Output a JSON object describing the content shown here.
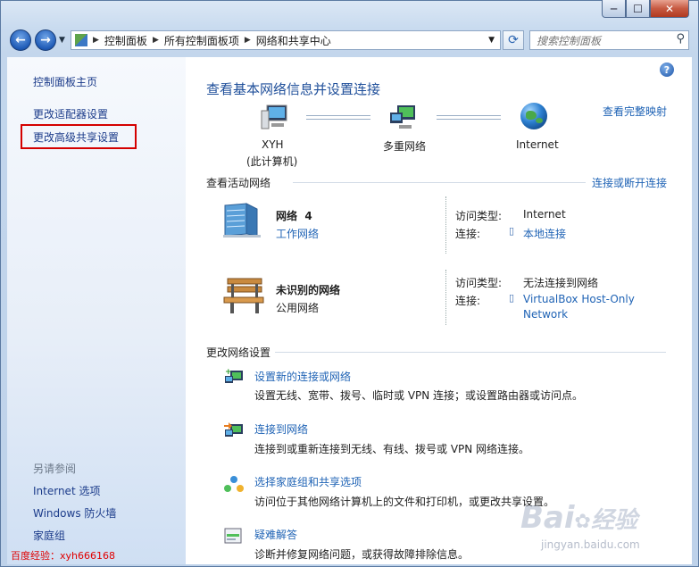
{
  "window": {
    "min_glyph": "─",
    "max_glyph": "☐",
    "close_glyph": "✕"
  },
  "address": {
    "crumbs": [
      "控制面板",
      "所有控制面板项",
      "网络和共享中心"
    ],
    "search_placeholder": "搜索控制面板"
  },
  "sidebar": {
    "home": "控制面板主页",
    "links": [
      "更改适配器设置",
      "更改高级共享设置"
    ],
    "see_also_title": "另请参阅",
    "see_also": [
      "Internet 选项",
      "Windows 防火墙",
      "家庭组"
    ]
  },
  "main": {
    "title": "查看基本网络信息并设置连接",
    "full_map": "查看完整映射",
    "map": {
      "computer_name": "XYH",
      "computer_sub": "(此计算机)",
      "multi": "多重网络",
      "internet": "Internet"
    },
    "active_title": "查看活动网络",
    "connect_link": "连接或断开连接",
    "networks": [
      {
        "name": "网络  4",
        "type": "工作网络",
        "access_label": "访问类型:",
        "access": "Internet",
        "conn_label": "连接:",
        "conn": "本地连接"
      },
      {
        "name": "未识别的网络",
        "type": "公用网络",
        "access_label": "访问类型:",
        "access": "无法连接到网络",
        "conn_label": "连接:",
        "conn": "VirtualBox Host-Only",
        "conn2": "Network"
      }
    ],
    "change_title": "更改网络设置",
    "tasks": [
      {
        "link": "设置新的连接或网络",
        "desc": "设置无线、宽带、拨号、临时或 VPN 连接；或设置路由器或访问点。"
      },
      {
        "link": "连接到网络",
        "desc": "连接到或重新连接到无线、有线、拨号或 VPN 网络连接。"
      },
      {
        "link": "选择家庭组和共享选项",
        "desc": "访问位于其他网络计算机上的文件和打印机，或更改共享设置。"
      },
      {
        "link": "疑难解答",
        "desc": "诊断并修复网络问题，或获得故障排除信息。"
      }
    ]
  },
  "watermark": {
    "left": "百度经验：xyh666168",
    "brand": "Bai",
    "brand2": "经验",
    "url": "jingyan.baidu.com"
  },
  "colors": {
    "link": "#1f63b5",
    "highlight": "#d40000"
  }
}
